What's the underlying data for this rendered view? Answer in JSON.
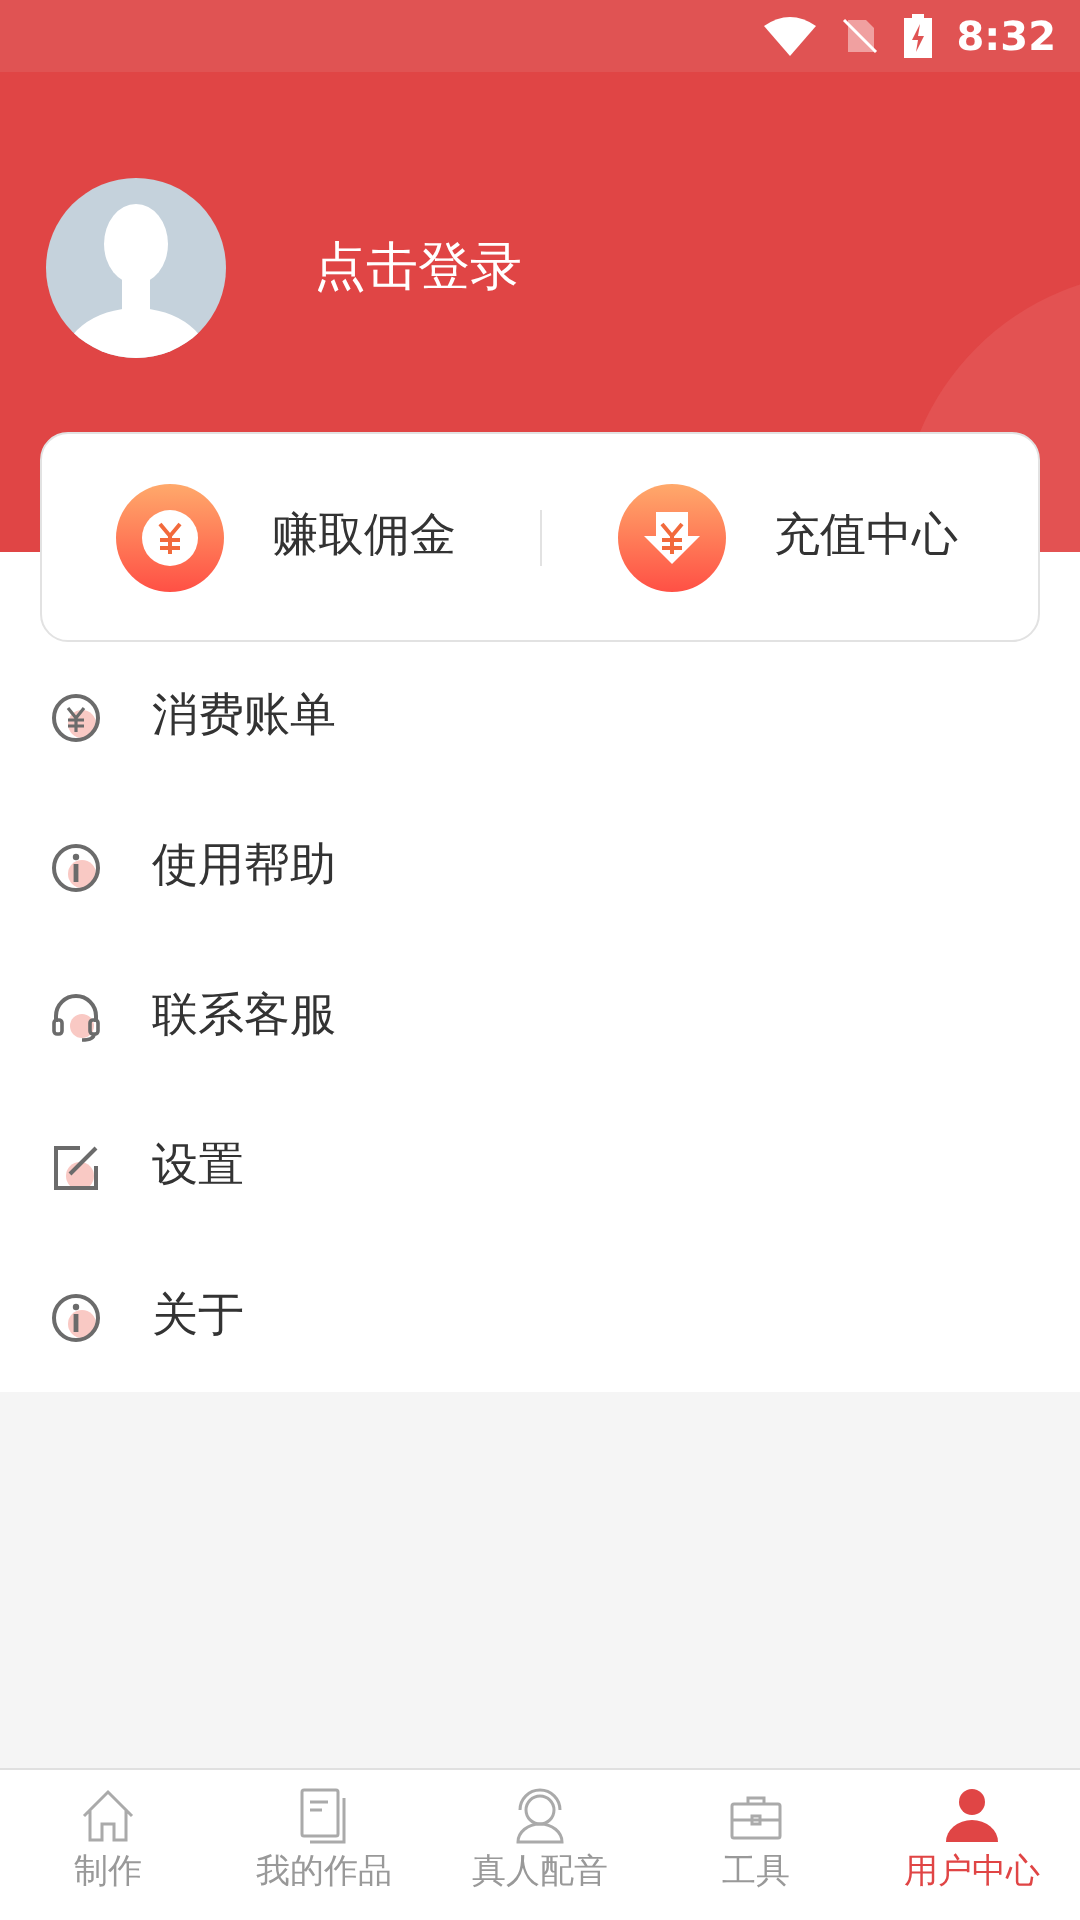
{
  "status_bar": {
    "time": "8:32"
  },
  "profile": {
    "login": "点击登录"
  },
  "quick_actions": [
    {
      "label": "赚取佣金"
    },
    {
      "label": "充值中心"
    }
  ],
  "menu": [
    {
      "label": "消费账单"
    },
    {
      "label": "使用帮助"
    },
    {
      "label": "联系客服"
    },
    {
      "label": "设置"
    },
    {
      "label": "关于"
    }
  ],
  "bottom_nav": [
    {
      "label": "制作",
      "selected": false
    },
    {
      "label": "我的作品",
      "selected": false
    },
    {
      "label": "真人配音",
      "selected": false
    },
    {
      "label": "工具",
      "selected": false
    },
    {
      "label": "用户中心",
      "selected": true
    }
  ]
}
